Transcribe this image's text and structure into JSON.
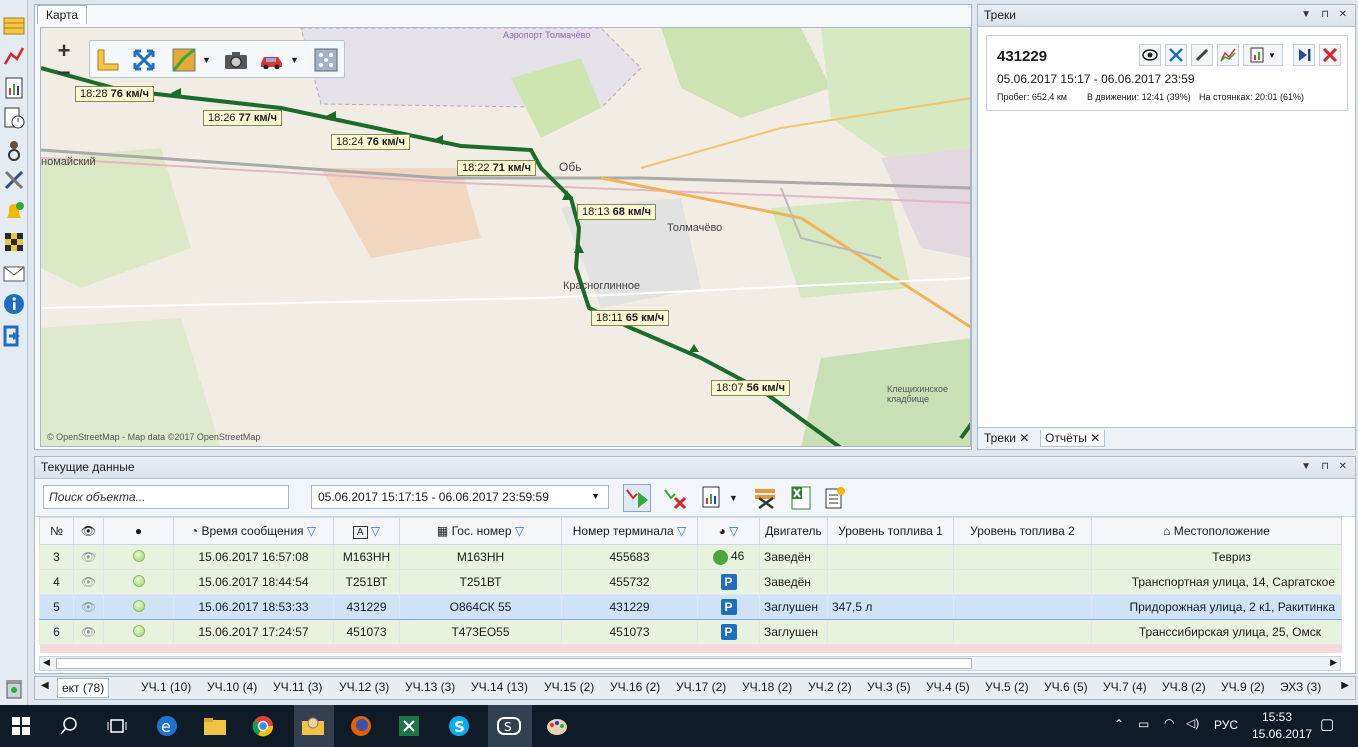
{
  "map": {
    "tab_label": "Карта",
    "copyright": "© OpenStreetMap - Map data ©2017 OpenStreetMap",
    "zoom_in": "+",
    "zoom_out": "−",
    "places": [
      "Аэропорт Толмачёво",
      "Обь",
      "Толмачёво",
      "Красноглинное",
      "Клещихинское кладбище",
      "номайский"
    ],
    "speed_labels": [
      {
        "time": "18:28",
        "speed": "76 км/ч"
      },
      {
        "time": "18:26",
        "speed": "77 км/ч"
      },
      {
        "time": "18:24",
        "speed": "76 км/ч"
      },
      {
        "time": "18:22",
        "speed": "71 км/ч"
      },
      {
        "time": "18:13",
        "speed": "68 км/ч"
      },
      {
        "time": "18:11",
        "speed": "65 км/ч"
      },
      {
        "time": "18:07",
        "speed": "56 км/ч"
      }
    ]
  },
  "tracks": {
    "title": "Треки",
    "card": {
      "id": "431229",
      "period": "05.06.2017 15:17 - 06.06.2017 23:59",
      "mileage": "Пробег: 652,4 км",
      "moving": "В движении: 12:41 (39%)",
      "parked": "На стоянках: 20:01 (61%)"
    },
    "bottom_tabs": [
      "Треки",
      "Отчёты"
    ]
  },
  "current": {
    "title": "Текущие данные",
    "search_placeholder": "Поиск объекта...",
    "date_range": "05.06.2017 15:17:15 - 06.06.2017 23:59:59",
    "columns": [
      "№",
      "",
      "",
      "Время сообщения",
      "",
      "Гос. номер",
      "Номер терминала",
      "",
      "Двигатель",
      "Уровень топлива 1",
      "Уровень топлива 2",
      "Местоположение"
    ],
    "rows": [
      {
        "n": "3",
        "time": "15.06.2017 16:57:08",
        "name": "М163НН",
        "plate": "М163НН",
        "terminal": "455683",
        "status": "46",
        "engine": "Заведён",
        "fuel1": "",
        "fuel2": "",
        "location": "Тевриз"
      },
      {
        "n": "4",
        "time": "15.06.2017 18:44:54",
        "name": "Т251ВТ",
        "plate": "Т251ВТ",
        "terminal": "455732",
        "status": "P",
        "engine": "Заведён",
        "fuel1": "",
        "fuel2": "",
        "location": "Транспортная улица, 14, Саргатское"
      },
      {
        "n": "5",
        "time": "15.06.2017 18:53:33",
        "name": "431229",
        "plate": "О864СК 55",
        "terminal": "431229",
        "status": "P",
        "engine": "Заглушен",
        "fuel1": "347,5 л",
        "fuel2": "",
        "location": "Придорожная улица, 2 к1, Ракитинка"
      },
      {
        "n": "6",
        "time": "15.06.2017 17:24:57",
        "name": "451073",
        "plate": "Т473ЕО55",
        "terminal": "451073",
        "status": "P",
        "engine": "Заглушен",
        "fuel1": "",
        "fuel2": "",
        "location": "Транссибирская улица, 25, Омск"
      }
    ]
  },
  "group_tabs": [
    "ект (78)",
    "УЧ.1 (10)",
    "УЧ.10 (4)",
    "УЧ.11 (3)",
    "УЧ.12 (3)",
    "УЧ.13 (3)",
    "УЧ.14 (13)",
    "УЧ.15 (2)",
    "УЧ.16 (2)",
    "УЧ.17 (2)",
    "УЧ.18 (2)",
    "УЧ.2 (2)",
    "УЧ.3 (5)",
    "УЧ.4 (5)",
    "УЧ.5 (2)",
    "УЧ.6 (5)",
    "УЧ.7 (4)",
    "УЧ.8 (2)",
    "УЧ.9 (2)",
    "ЭХЗ (3)"
  ],
  "taskbar": {
    "lang": "РУС",
    "time": "15:53",
    "date": "15.06.2017"
  },
  "colors": {
    "track": "#1d6b2a",
    "accent": "#1f6fbf",
    "taskbar": "#101b28"
  }
}
